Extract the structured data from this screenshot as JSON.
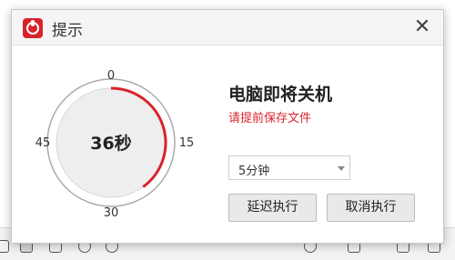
{
  "dialog": {
    "title": "提示",
    "heading": "电脑即将关机",
    "subtext": "请提前保存文件",
    "countdown_text": "36秒",
    "countdown_progress": 0.4,
    "dial_labels": {
      "top": "0",
      "right": "15",
      "bottom": "30",
      "left": "45"
    },
    "delay_select": {
      "value": "5分钟"
    },
    "buttons": {
      "delay": "延迟执行",
      "cancel": "取消执行"
    }
  },
  "colors": {
    "accent": "#d9232a",
    "dial_fill": "#eeeeee",
    "dial_ring": "#aaaaaa"
  },
  "icons": {
    "app": "clock-power-icon",
    "close": "close-icon",
    "dropdown": "chevron-down-icon"
  }
}
